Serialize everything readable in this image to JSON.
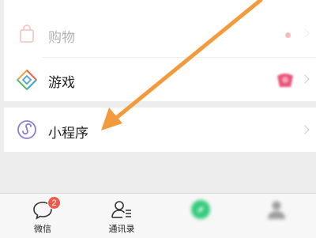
{
  "menu": {
    "shopping": {
      "label": "购物",
      "icon": "shopping-bag-icon",
      "hint": ""
    },
    "games": {
      "label": "游戏",
      "icon": "games-diamond-icon",
      "hint": ""
    },
    "mini_programs": {
      "label": "小程序",
      "icon": "mini-program-icon"
    }
  },
  "tabbar": {
    "chats": {
      "label": "微信",
      "badge": "2",
      "icon": "chat-bubble-icon"
    },
    "contacts": {
      "label": "通讯录",
      "icon": "contacts-icon"
    },
    "discover": {
      "label": "",
      "icon": "compass-icon"
    },
    "me": {
      "label": "",
      "icon": "person-icon"
    }
  },
  "colors": {
    "background": "#ededed",
    "panel": "#ffffff",
    "badge": "#f05a4a",
    "discover_green": "#07c160",
    "arrow": "#f39a3c"
  }
}
